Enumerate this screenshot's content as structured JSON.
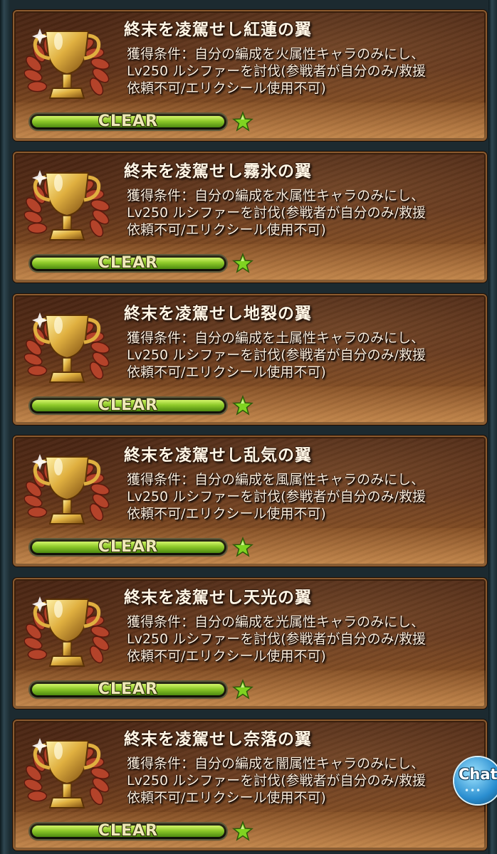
{
  "achievements": [
    {
      "title": "終末を凌駕せし紅蓮の翼",
      "condition": "獲得条件：自分の編成を火属性キャラのみにし、\nLv250 ルシファーを討伐(参戦者が自分のみ/救援\n依頼不可/エリクシール使用不可)",
      "status": "CLEAR",
      "progress": 1.0
    },
    {
      "title": "終末を凌駕せし霧氷の翼",
      "condition": "獲得条件：自分の編成を水属性キャラのみにし、\nLv250 ルシファーを討伐(参戦者が自分のみ/救援\n依頼不可/エリクシール使用不可)",
      "status": "CLEAR",
      "progress": 1.0
    },
    {
      "title": "終末を凌駕せし地裂の翼",
      "condition": "獲得条件：自分の編成を土属性キャラのみにし、\nLv250 ルシファーを討伐(参戦者が自分のみ/救援\n依頼不可/エリクシール使用不可)",
      "status": "CLEAR",
      "progress": 1.0
    },
    {
      "title": "終末を凌駕せし乱気の翼",
      "condition": "獲得条件：自分の編成を風属性キャラのみにし、\nLv250 ルシファーを討伐(参戦者が自分のみ/救援\n依頼不可/エリクシール使用不可)",
      "status": "CLEAR",
      "progress": 1.0
    },
    {
      "title": "終末を凌駕せし天光の翼",
      "condition": "獲得条件：自分の編成を光属性キャラのみにし、\nLv250 ルシファーを討伐(参戦者が自分のみ/救援\n依頼不可/エリクシール使用不可)",
      "status": "CLEAR",
      "progress": 1.0
    },
    {
      "title": "終末を凌駕せし奈落の翼",
      "condition": "獲得条件：自分の編成を闇属性キャラのみにし、\nLv250 ルシファーを討伐(参戦者が自分のみ/救援\n依頼不可/エリクシール使用不可)",
      "status": "CLEAR",
      "progress": 1.0
    }
  ],
  "icons": {
    "trophy": "trophy-icon",
    "star": "star-icon"
  },
  "colors": {
    "progress_green": "#8ec92a",
    "star_green": "#7fd321",
    "trophy_gold": "#e0b040",
    "laurel_red": "#b4432a"
  },
  "chat": {
    "label": "Chat",
    "dots": "•••"
  }
}
